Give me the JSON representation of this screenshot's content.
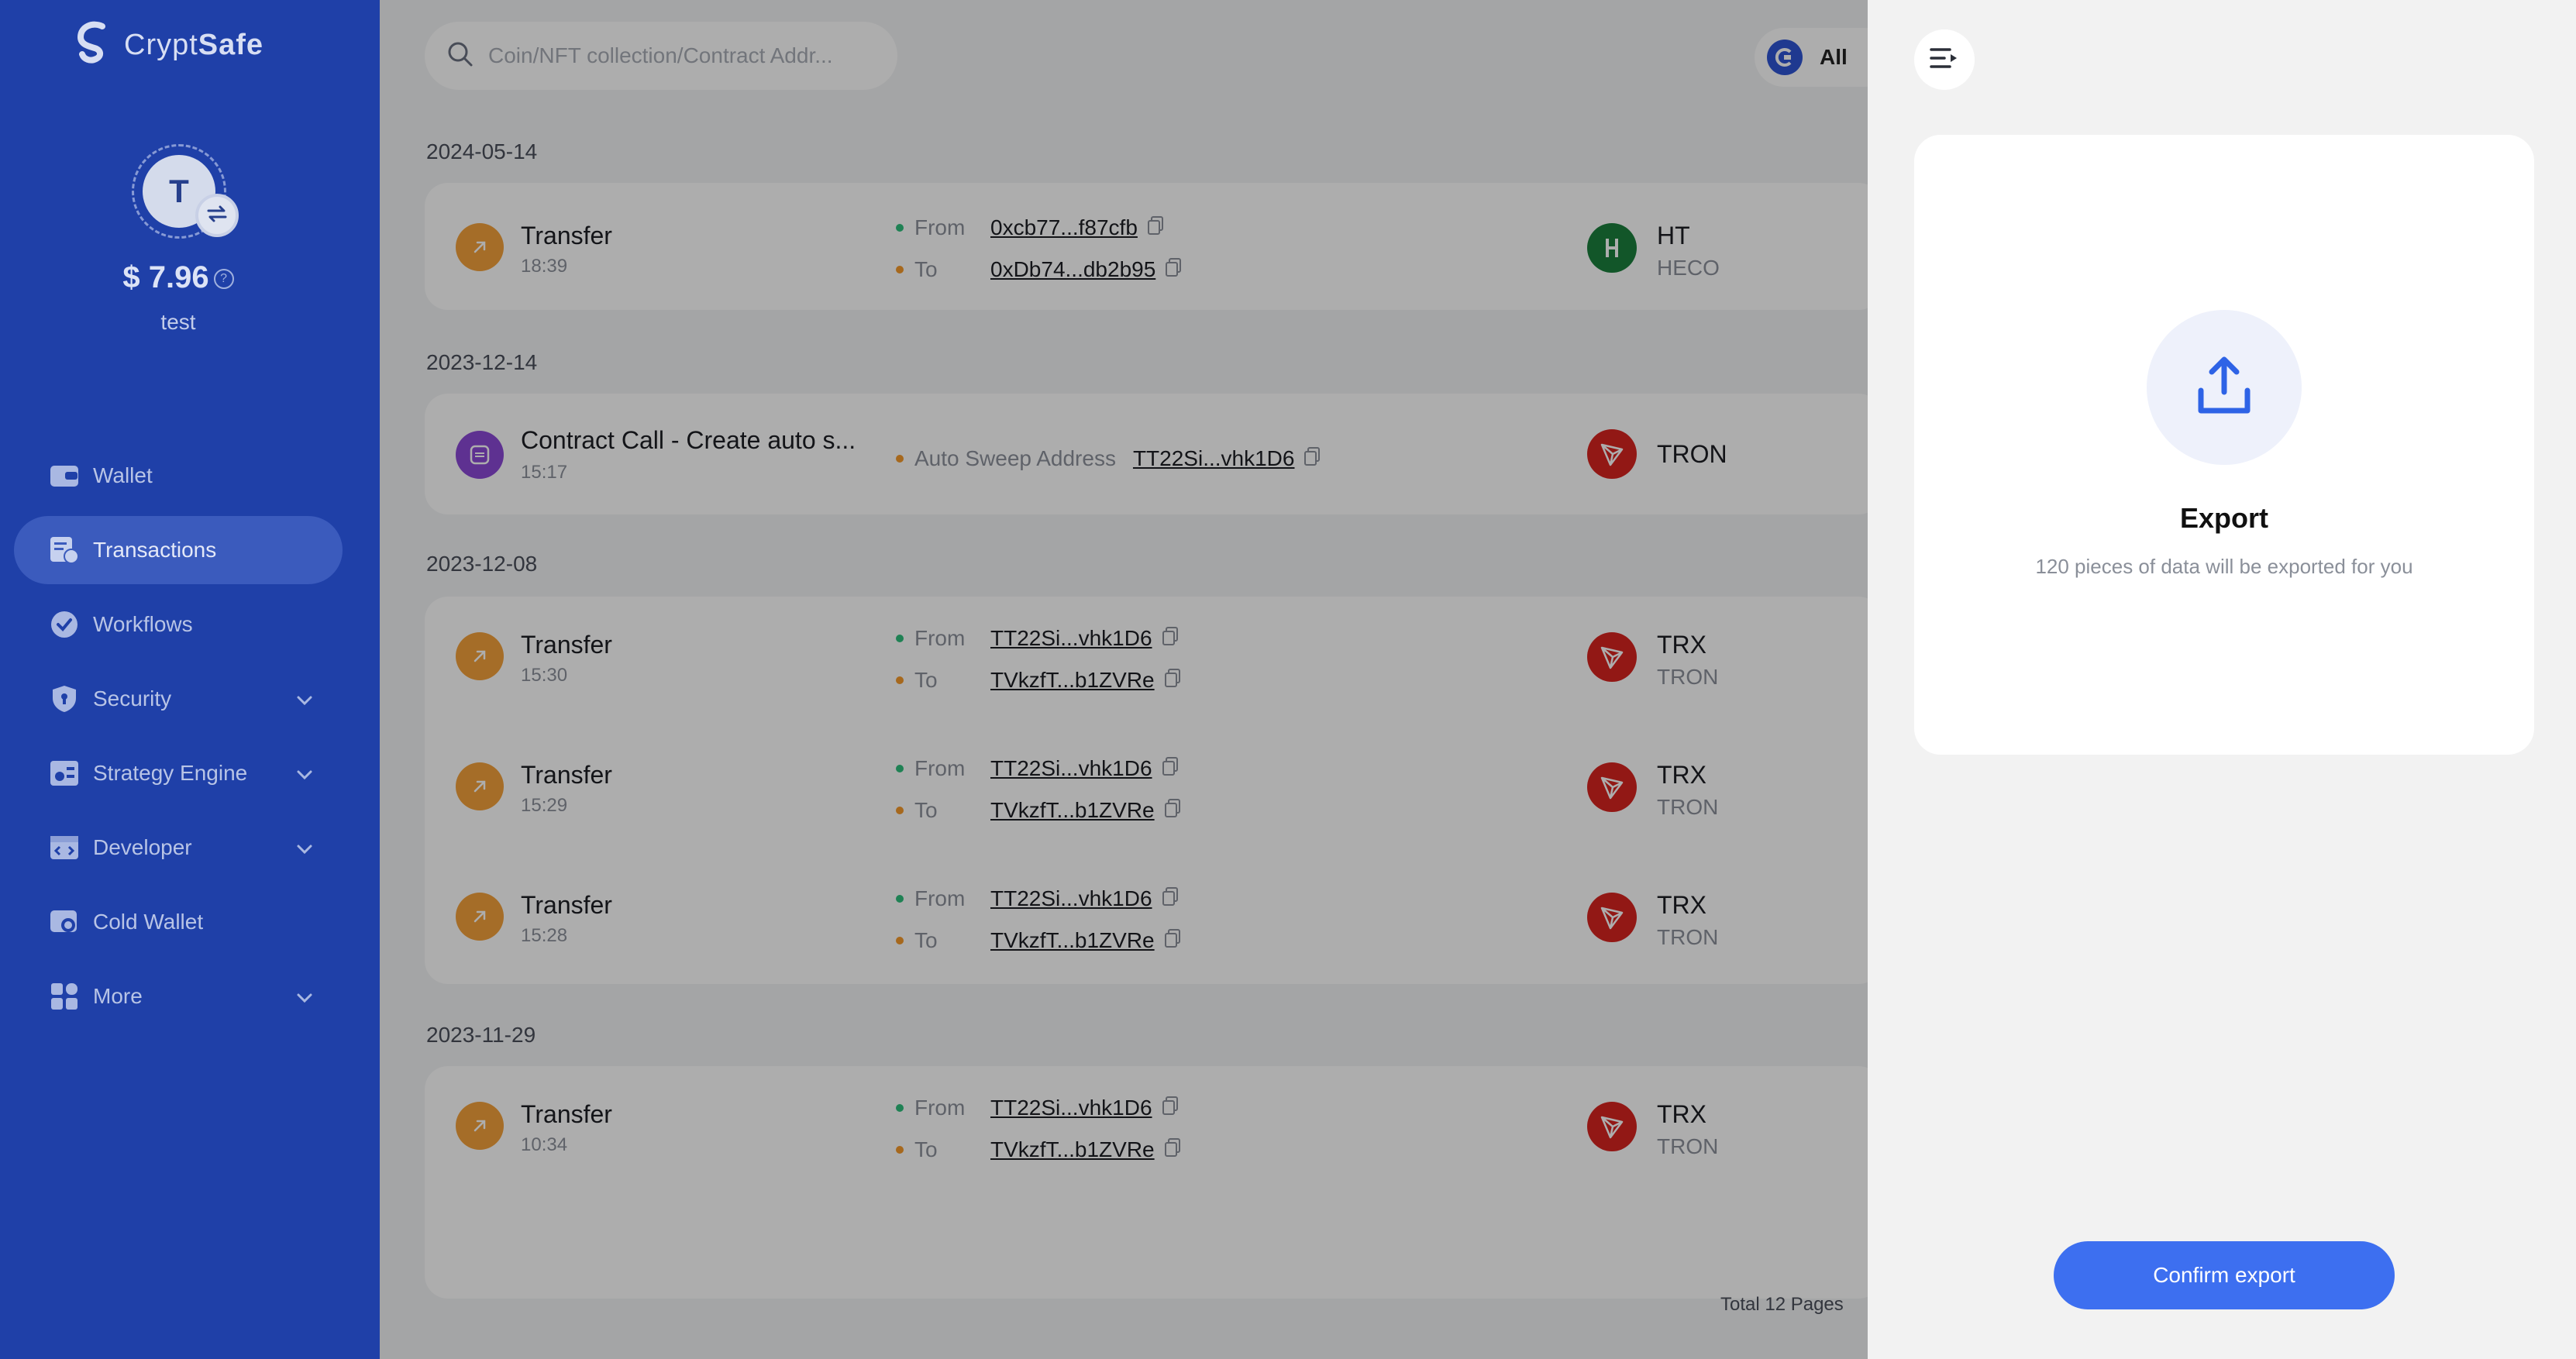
{
  "app": {
    "logo_regular": "Crypt",
    "logo_bold": "Safe"
  },
  "account": {
    "initial": "T",
    "balance": "$ 7.96",
    "name": "test"
  },
  "sidebar": {
    "items": [
      {
        "label": "Wallet",
        "icon": "wallet-icon",
        "active": false
      },
      {
        "label": "Transactions",
        "icon": "transactions-icon",
        "active": true
      },
      {
        "label": "Workflows",
        "icon": "workflows-icon",
        "active": false
      },
      {
        "label": "Security",
        "icon": "shield-icon",
        "active": false,
        "expandable": true
      },
      {
        "label": "Strategy Engine",
        "icon": "strategy-icon",
        "active": false,
        "expandable": true
      },
      {
        "label": "Developer",
        "icon": "developer-icon",
        "active": false,
        "expandable": true
      },
      {
        "label": "Cold Wallet",
        "icon": "cold-wallet-icon",
        "active": false
      },
      {
        "label": "More",
        "icon": "more-grid-icon",
        "active": false,
        "expandable": true
      }
    ]
  },
  "search": {
    "placeholder": "Coin/NFT collection/Contract Addr..."
  },
  "chain_filter": {
    "label": "All"
  },
  "groups": [
    {
      "date": "2024-05-14",
      "transactions": [
        {
          "title": "Transfer",
          "time": "18:39",
          "from_label": "From",
          "from": "0xcb77...f87cfb",
          "to_label": "To",
          "to": "0xDb74...db2b95",
          "coin": "HT",
          "network": "HECO"
        }
      ]
    },
    {
      "date": "2023-12-14",
      "transactions": [
        {
          "title": "Contract Call - Create auto s...",
          "time": "15:17",
          "addr_label": "Auto Sweep Address",
          "addr": "TT22Si...vhk1D6",
          "coin": "TRON"
        }
      ]
    },
    {
      "date": "2023-12-08",
      "transactions": [
        {
          "title": "Transfer",
          "time": "15:30",
          "from_label": "From",
          "from": "TT22Si...vhk1D6",
          "to_label": "To",
          "to": "TVkzfT...b1ZVRe",
          "coin": "TRX",
          "network": "TRON"
        },
        {
          "title": "Transfer",
          "time": "15:29",
          "from_label": "From",
          "from": "TT22Si...vhk1D6",
          "to_label": "To",
          "to": "TVkzfT...b1ZVRe",
          "coin": "TRX",
          "network": "TRON"
        },
        {
          "title": "Transfer",
          "time": "15:28",
          "from_label": "From",
          "from": "TT22Si...vhk1D6",
          "to_label": "To",
          "to": "TVkzfT...b1ZVRe",
          "coin": "TRX",
          "network": "TRON"
        }
      ]
    },
    {
      "date": "2023-11-29",
      "transactions": [
        {
          "title": "Transfer",
          "time": "10:34",
          "from_label": "From",
          "from": "TT22Si...vhk1D6",
          "to_label": "To",
          "to": "TVkzfT...b1ZVRe",
          "coin": "TRX",
          "network": "TRON"
        }
      ]
    }
  ],
  "pagination": {
    "total": "Total 12 Pages"
  },
  "drawer": {
    "export_title": "Export",
    "export_desc": "120 pieces of data will be exported for you",
    "confirm_label": "Confirm export"
  },
  "colors": {
    "sidebar_bg": "#1f40a8",
    "accent": "#3d6ff0",
    "transfer_icon": "#f3a13b",
    "contract_icon": "#8b49d6",
    "tron_red": "#d8241f",
    "heco_green": "#1b7f3d"
  }
}
